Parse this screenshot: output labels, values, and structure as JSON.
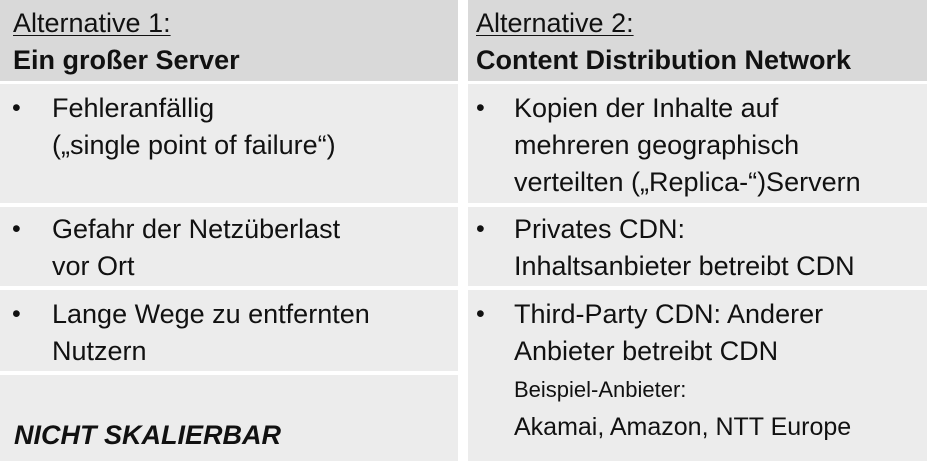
{
  "left": {
    "alternative_label": "Alternative 1:",
    "title": "Ein großer Server",
    "items": [
      {
        "line1": "Fehleranfällig",
        "line2": "(„single point of failure“)"
      },
      {
        "line1": "Gefahr der Netzüberlast",
        "line2": "vor Ort"
      },
      {
        "line1": "Lange Wege zu entfernten",
        "line2": "Nutzern"
      }
    ],
    "conclusion": "NICHT SKALIERBAR"
  },
  "right": {
    "alternative_label": "Alternative 2:",
    "title": "Content Distribution Network",
    "items": [
      {
        "line1": "Kopien der Inhalte auf",
        "line2": "mehreren geographisch",
        "line3": "verteilten („Replica-“)Servern"
      },
      {
        "line1": "Privates CDN:",
        "line2": "Inhaltsanbieter betreibt CDN"
      },
      {
        "line1": "Third-Party CDN: Anderer",
        "line2": "Anbieter betreibt CDN"
      }
    ],
    "example_title": "Beispiel-Anbieter:",
    "example_list": "Akamai, Amazon, NTT Europe"
  },
  "bullet_char": "•"
}
